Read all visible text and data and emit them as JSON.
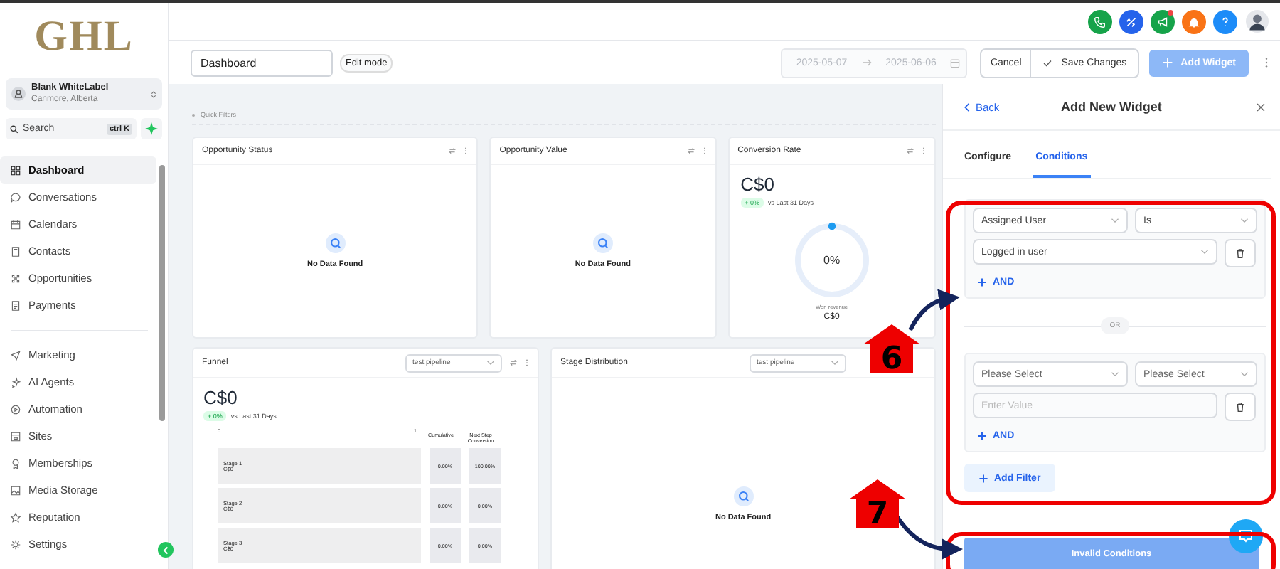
{
  "sidebar": {
    "logo": "GHL",
    "account": {
      "name": "Blank WhiteLabel",
      "location": "Canmore, Alberta"
    },
    "search": {
      "placeholder": "Search",
      "shortcut": "ctrl K"
    },
    "nav_groups": [
      [
        {
          "label": "Dashboard",
          "selected": true
        },
        {
          "label": "Conversations",
          "selected": false
        },
        {
          "label": "Calendars",
          "selected": false
        },
        {
          "label": "Contacts",
          "selected": false
        },
        {
          "label": "Opportunities",
          "selected": false
        },
        {
          "label": "Payments",
          "selected": false
        }
      ],
      [
        {
          "label": "Marketing",
          "selected": false
        },
        {
          "label": "AI Agents",
          "selected": false
        },
        {
          "label": "Automation",
          "selected": false
        },
        {
          "label": "Sites",
          "selected": false
        },
        {
          "label": "Memberships",
          "selected": false
        },
        {
          "label": "Media Storage",
          "selected": false
        },
        {
          "label": "Reputation",
          "selected": false
        },
        {
          "label": "Settings",
          "selected": false
        }
      ]
    ]
  },
  "toolbar": {
    "dashboard_name": "Dashboard",
    "edit_mode": "Edit mode",
    "date_start": "2025-05-07",
    "date_end": "2025-06-06",
    "cancel": "Cancel",
    "save": "Save Changes",
    "add_widget": "Add Widget"
  },
  "quick_filters": "Quick Filters",
  "widgets": [
    {
      "kind": "empty",
      "title": "Opportunity Status",
      "message": "No Data Found"
    },
    {
      "kind": "empty",
      "title": "Opportunity Value",
      "message": "No Data Found"
    },
    {
      "kind": "rate",
      "title": "Conversion Rate",
      "amount": "C$0",
      "change": "+ 0%",
      "compare": "vs Last 31 Days",
      "rate": "0%",
      "caption": "Won revenue",
      "caption_value": "C$0"
    }
  ],
  "widgets_row_2": [
    {
      "kind": "funnel",
      "title": "Funnel",
      "pipeline": "test pipeline",
      "amount": "C$0",
      "change": "+ 0%",
      "compare": "vs Last 31 Days",
      "axis_start": "0",
      "axis_end": "1",
      "col_cumulative": "Cumulative",
      "col_next": "Next Step Conversion",
      "stages": [
        {
          "name": "Stage 1",
          "value": "C$0",
          "cumulative": "0.00%",
          "next": "100.00%"
        },
        {
          "name": "Stage 2",
          "value": "C$0",
          "cumulative": "0.00%",
          "next": "0.00%"
        },
        {
          "name": "Stage 3",
          "value": "C$0",
          "cumulative": "0.00%",
          "next": "0.00%"
        }
      ]
    },
    {
      "kind": "empty",
      "title": "Stage Distribution",
      "pipeline": "test pipeline",
      "message": "No Data Found"
    }
  ],
  "panel": {
    "back": "Back",
    "title": "Add New Widget",
    "tabs": [
      {
        "label": "Configure",
        "selected": false
      },
      {
        "label": "Conditions",
        "selected": true
      }
    ],
    "groups": [
      {
        "field": {
          "value": "Assigned User"
        },
        "operator": {
          "value": "Is"
        },
        "match": {
          "kind": "select",
          "value": "Logged in user"
        },
        "add": "AND"
      },
      {
        "field": {
          "placeholder": "Please Select"
        },
        "operator": {
          "placeholder": "Please Select"
        },
        "match": {
          "kind": "input",
          "placeholder": "Enter Value"
        },
        "add": "AND"
      }
    ],
    "or_label": "OR",
    "add_filter": "Add Filter",
    "submit": "Invalid Conditions"
  },
  "markers": [
    {
      "label": "6"
    },
    {
      "label": "7"
    }
  ]
}
